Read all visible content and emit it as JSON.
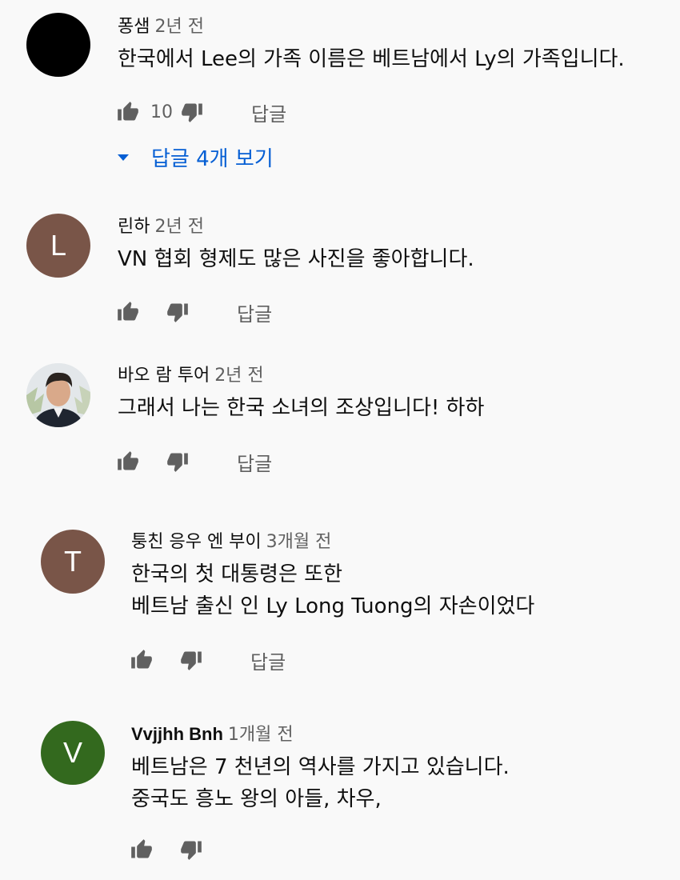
{
  "colors": {
    "background": "#f9f9f9",
    "link": "#065fd4",
    "secondary": "#606060",
    "avatar_brown": "#795548",
    "avatar_green": "#33691e",
    "avatar_black": "#000000"
  },
  "reply_label": "답글",
  "comments": [
    {
      "author": "퐁샘",
      "time": "2년 전",
      "lines": [
        "한국에서 Lee의 가족 이름은 베트남에서 Ly의 가족입니다."
      ],
      "likes": "10",
      "avatar_letter": "",
      "view_replies": "답글 4개 보기"
    },
    {
      "author": "린하",
      "time": "2년 전",
      "lines": [
        "VN 협회 형제도 많은 사진을 좋아합니다."
      ],
      "likes": "",
      "avatar_letter": "L"
    },
    {
      "author": "바오 람 투어",
      "time": "2년 전",
      "lines": [
        "그래서 나는 한국 소녀의 조상입니다! 하하"
      ],
      "likes": "",
      "avatar_letter": ""
    },
    {
      "author": "퉁친 응우 엔 부이",
      "time": "3개월 전",
      "lines": [
        "한국의 첫 대통령은 또한",
        "베트남 출신 인 Ly Long Tuong의 자손이었다"
      ],
      "likes": "",
      "avatar_letter": "T"
    },
    {
      "author": "Vvjjhh Bnh",
      "time": "1개월 전",
      "lines": [
        "베트남은 7 천년의 역사를 가지고 있습니다.",
        "중국도 흥노 왕의 아들, 차우,"
      ],
      "likes": "",
      "avatar_letter": "V"
    }
  ]
}
